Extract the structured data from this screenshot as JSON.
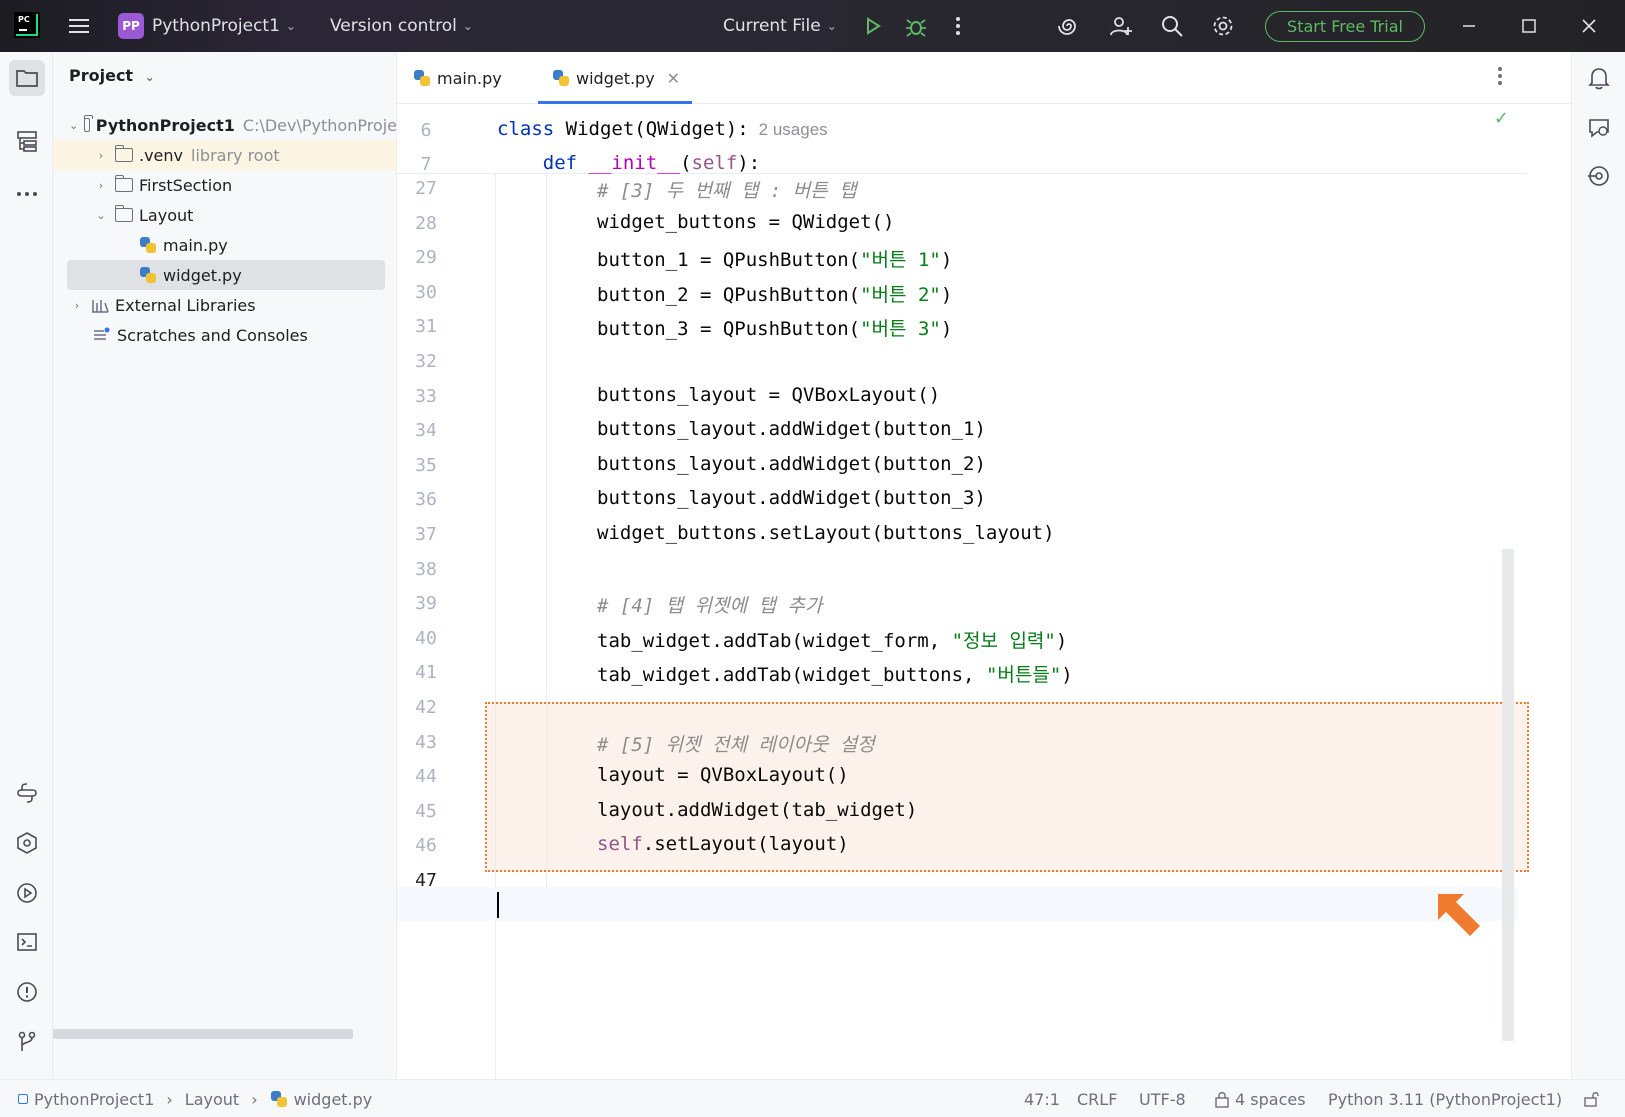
{
  "titlebar": {
    "project_badge": "PP",
    "project_name": "PythonProject1",
    "vcs_label": "Version control",
    "run_config": "Current File",
    "trial_button": "Start Free Trial",
    "logo_text": "PC"
  },
  "project_panel": {
    "header": "Project",
    "tree": [
      {
        "label": "PythonProject1",
        "hint": "C:\\Dev\\PythonProje",
        "kind": "root"
      },
      {
        "label": ".venv",
        "hint": "library root",
        "kind": "folder"
      },
      {
        "label": "FirstSection",
        "hint": "",
        "kind": "folder"
      },
      {
        "label": "Layout",
        "hint": "",
        "kind": "folder"
      },
      {
        "label": "main.py",
        "hint": "",
        "kind": "file"
      },
      {
        "label": "widget.py",
        "hint": "",
        "kind": "file",
        "selected": true
      },
      {
        "label": "External Libraries",
        "hint": "",
        "kind": "libs"
      },
      {
        "label": "Scratches and Consoles",
        "hint": "",
        "kind": "scratch"
      }
    ]
  },
  "editor": {
    "tabs": [
      {
        "label": "main.py",
        "active": false
      },
      {
        "label": "widget.py",
        "active": true
      }
    ],
    "sticky_lines": [
      {
        "num": "6",
        "pre": "",
        "kw": "class",
        "text": " Widget(QWidget):",
        "usages": "2 usages"
      },
      {
        "num": "7",
        "pre": "    ",
        "kw": "def",
        "text": "",
        "magic": "__init__",
        "self": "self",
        "tail": "):"
      }
    ],
    "lines": [
      {
        "num": "27",
        "comment": "# [3] 두 번째 탭 : 버튼 탭"
      },
      {
        "num": "28",
        "code": "widget_buttons = QWidget()"
      },
      {
        "num": "29",
        "code": "button_1 = QPushButton(",
        "string": "\"버튼 1\"",
        "tail": ")"
      },
      {
        "num": "30",
        "code": "button_2 = QPushButton(",
        "string": "\"버튼 2\"",
        "tail": ")"
      },
      {
        "num": "31",
        "code": "button_3 = QPushButton(",
        "string": "\"버튼 3\"",
        "tail": ")"
      },
      {
        "num": "32",
        "code": ""
      },
      {
        "num": "33",
        "code": "buttons_layout = QVBoxLayout()"
      },
      {
        "num": "34",
        "code": "buttons_layout.addWidget(button_1)"
      },
      {
        "num": "35",
        "code": "buttons_layout.addWidget(button_2)"
      },
      {
        "num": "36",
        "code": "buttons_layout.addWidget(button_3)"
      },
      {
        "num": "37",
        "code": "widget_buttons.setLayout(buttons_layout)"
      },
      {
        "num": "38",
        "code": ""
      },
      {
        "num": "39",
        "comment": "# [4] 탭 위젯에 탭 추가"
      },
      {
        "num": "40",
        "code": "tab_widget.addTab(widget_form, ",
        "string": "\"정보 입력\"",
        "tail": ")"
      },
      {
        "num": "41",
        "code": "tab_widget.addTab(widget_buttons, ",
        "string": "\"버튼들\"",
        "tail": ")"
      },
      {
        "num": "42",
        "code": ""
      },
      {
        "num": "43",
        "comment": "# [5] 위젯 전체 레이아웃 설정"
      },
      {
        "num": "44",
        "code": "layout = QVBoxLayout()"
      },
      {
        "num": "45",
        "code": "layout.addWidget(tab_widget)"
      },
      {
        "num": "46",
        "self": "self",
        "code": ".setLayout(layout)"
      },
      {
        "num": "47",
        "code": ""
      }
    ]
  },
  "statusbar": {
    "breadcrumb": [
      "PythonProject1",
      "Layout",
      "widget.py"
    ],
    "position": "47:1",
    "line_ending": "CRLF",
    "encoding": "UTF-8",
    "indent": "4 spaces",
    "interpreter": "Python 3.11 (PythonProject1)"
  },
  "colors": {
    "accent": "#3574f0",
    "trial_green": "#5fb865",
    "highlight_border": "#f07b2e",
    "keyword": "#0033b3",
    "string": "#067d17"
  }
}
